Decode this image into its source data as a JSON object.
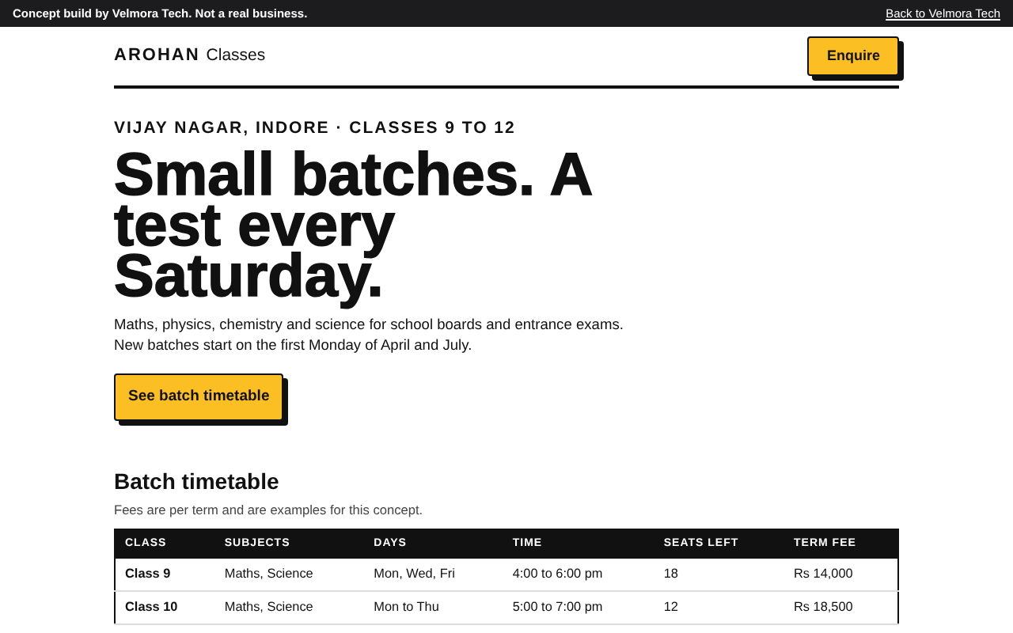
{
  "notice": {
    "text": "Concept build by Velmora Tech. Not a real business.",
    "link": "Back to Velmora Tech"
  },
  "header": {
    "brand": "AROHAN",
    "brand_suffix": "Classes",
    "button": "Enquire"
  },
  "hero": {
    "eyebrow": "VIJAY NAGAR, INDORE · CLASSES 9 TO 12",
    "title": "Small batches. A test every Saturday.",
    "text": "Maths, physics, chemistry and science for school boards and entrance exams. New batches start on the first Monday of April and July.",
    "button": "See batch timetable"
  },
  "timetable": {
    "title": "Batch timetable",
    "note": "Fees are per term and are examples for this concept.",
    "columns": [
      "CLASS",
      "SUBJECTS",
      "DAYS",
      "TIME",
      "SEATS LEFT",
      "TERM FEE"
    ],
    "rows": [
      [
        "Class 9",
        "Maths, Science",
        "Mon, Wed, Fri",
        "4:00 to 6:00 pm",
        "18",
        "Rs 14,000"
      ],
      [
        "Class 10",
        "Maths, Science",
        "Mon to Thu",
        "5:00 to 7:00 pm",
        "12",
        "Rs 18,500"
      ]
    ]
  }
}
